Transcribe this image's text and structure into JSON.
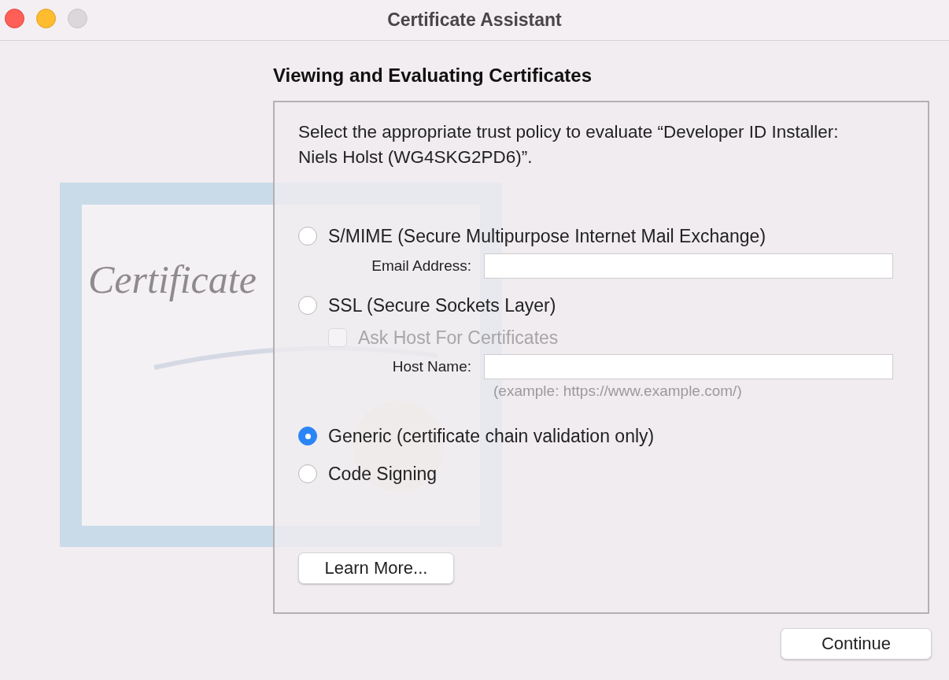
{
  "window": {
    "title": "Certificate Assistant"
  },
  "heading": "Viewing and Evaluating Certificates",
  "artwork": {
    "script": "Certificate"
  },
  "prompt": "Select the appropriate trust policy to evaluate “Developer ID Installer: Niels Holst (WG4SKG2PD6)”.",
  "policies": [
    {
      "label": "S/MIME (Secure Multipurpose Internet Mail Exchange)",
      "selected": false,
      "extras": [
        {
          "kind": "field",
          "label": "Email Address:"
        }
      ]
    },
    {
      "label": "SSL (Secure Sockets Layer)",
      "selected": false,
      "extras": [
        {
          "kind": "checkbox",
          "label": "Ask Host For Certificates",
          "checked": false,
          "disabled": true
        },
        {
          "kind": "field",
          "label": "Host Name:"
        },
        {
          "kind": "hint",
          "label": "(example: https://www.example.com/)"
        }
      ]
    },
    {
      "label": "Generic (certificate chain validation only)",
      "selected": true
    },
    {
      "label": "Code Signing",
      "selected": false
    }
  ],
  "learn_more": "Learn More...",
  "continue": "Continue"
}
